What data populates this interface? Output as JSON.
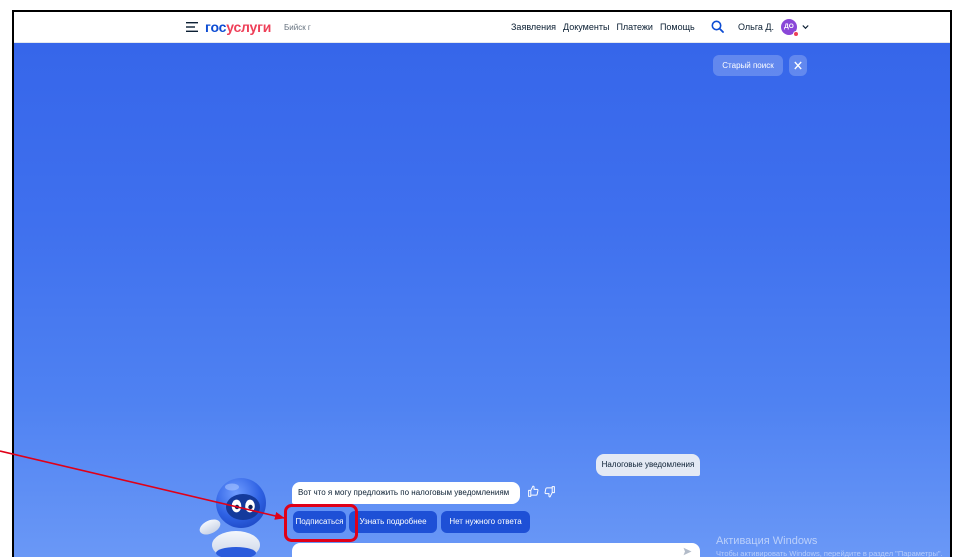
{
  "header": {
    "logo": {
      "part1": "гос",
      "part2": "услуги"
    },
    "city": "Бийск г",
    "nav": [
      "Заявления",
      "Документы",
      "Платежи",
      "Помощь"
    ],
    "user_name": "Ольга Д.",
    "avatar_initials": "ДО"
  },
  "search": {
    "old_search_label": "Старый поиск"
  },
  "chat": {
    "user_message": "Налоговые уведомления",
    "bot_message": "Вот что я могу предложить по налоговым уведомлениям",
    "quick_replies": [
      "Подписаться",
      "Узнать подробнее",
      "Нет нужного ответа"
    ]
  },
  "watermark": {
    "title": "Активация Windows",
    "subtitle": "Чтобы активировать Windows, перейдите в раздел \"Параметры\"."
  },
  "icons": {
    "menu": "menu-icon",
    "search": "search-icon",
    "chevron": "chevron-down-icon",
    "close": "close-icon",
    "like": "thumbs-up-icon",
    "dislike": "thumbs-down-icon",
    "send": "send-icon",
    "assistant": "robot-assistant-icon"
  },
  "colors": {
    "brand_blue": "#0d4cd3",
    "brand_red": "#ee3f58",
    "background_top": "#3666ea",
    "background_bottom": "#6a98f6",
    "quick_reply": "#1e50d6",
    "avatar": "#8a47d8",
    "annotation": "#e00018"
  }
}
